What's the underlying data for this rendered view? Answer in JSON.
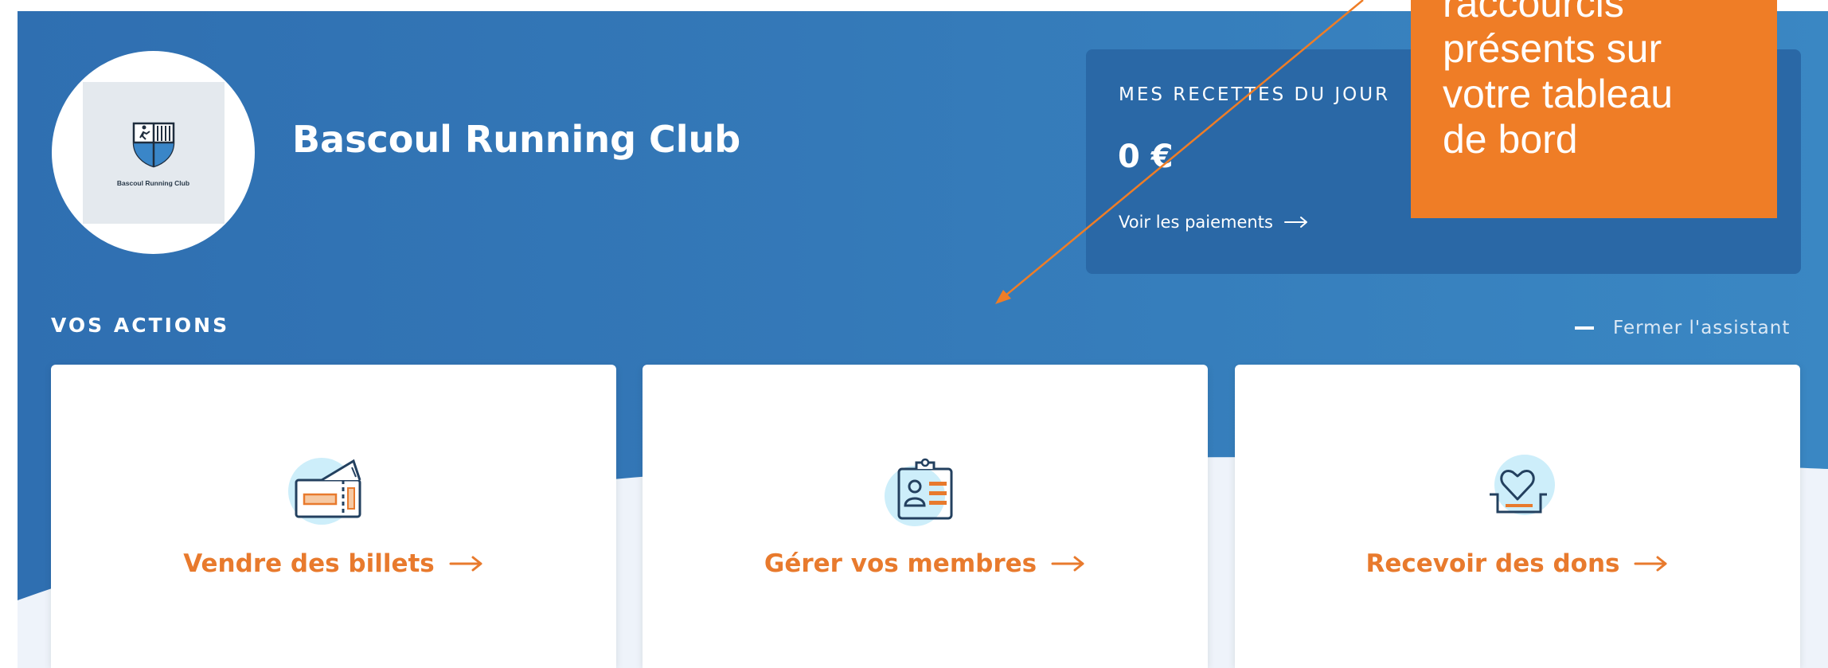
{
  "organization": {
    "name": "Bascoul Running Club",
    "logo_text": "Bascoul Running Club"
  },
  "revenue": {
    "title": "MES RECETTES DU JOUR",
    "amount": "0 €",
    "link_label": "Voir les paiements"
  },
  "actions": {
    "title": "VOS ACTIONS",
    "close_label": "Fermer l'assistant",
    "cards": [
      {
        "label": "Vendre des billets",
        "icon": "ticket-icon"
      },
      {
        "label": "Gérer vos membres",
        "icon": "member-card-icon"
      },
      {
        "label": "Recevoir des dons",
        "icon": "donation-heart-icon"
      }
    ]
  },
  "annotation": {
    "lines": [
      "raccourcis",
      "présents sur",
      "votre tableau",
      "de bord"
    ]
  },
  "colors": {
    "hero_blue": "#3479b8",
    "panel_blue": "#2a68a6",
    "accent_orange": "#e87a2d",
    "annotation_orange": "#ef7d26",
    "icon_circle": "#cdeefa"
  }
}
